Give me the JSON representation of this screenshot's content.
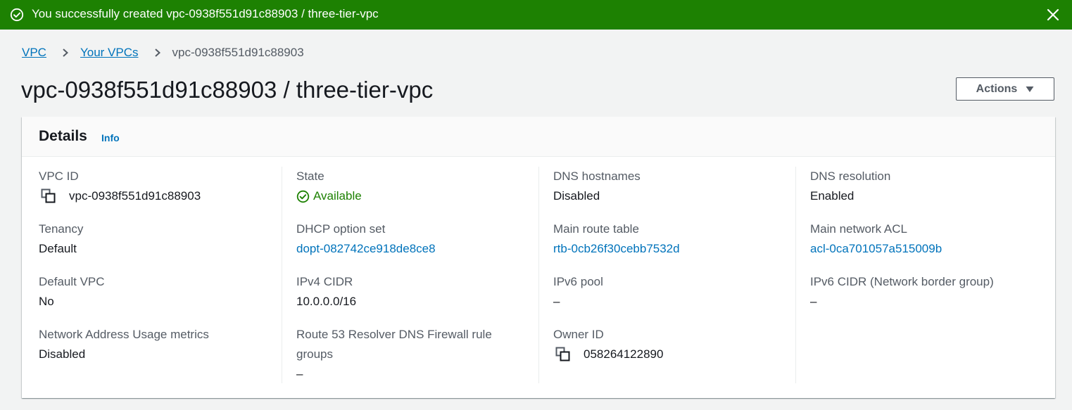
{
  "flash": {
    "message": "You successfully created vpc-0938f551d91c88903 / three-tier-vpc",
    "icon": "check-circle-icon",
    "close_icon": "close-icon",
    "color": "#1d8102"
  },
  "breadcrumb": {
    "items": [
      "VPC",
      "Your VPCs"
    ],
    "current": "vpc-0938f551d91c88903"
  },
  "header": {
    "title": "vpc-0938f551d91c88903 / three-tier-vpc",
    "actions_label": "Actions"
  },
  "details": {
    "title": "Details",
    "info_label": "Info",
    "columns": [
      [
        {
          "label": "VPC ID",
          "value": "vpc-0938f551d91c88903",
          "copy": true
        },
        {
          "label": "Tenancy",
          "value": "Default"
        },
        {
          "label": "Default VPC",
          "value": "No"
        },
        {
          "label": "Network Address Usage metrics",
          "value": "Disabled"
        }
      ],
      [
        {
          "label": "State",
          "value": "Available",
          "status": "success"
        },
        {
          "label": "DHCP option set",
          "value": "dopt-082742ce918de8ce8",
          "link": true
        },
        {
          "label": "IPv4 CIDR",
          "value": "10.0.0.0/16"
        },
        {
          "label": "Route 53 Resolver DNS Firewall rule",
          "label2": "groups",
          "value": "–"
        }
      ],
      [
        {
          "label": "DNS hostnames",
          "value": "Disabled"
        },
        {
          "label": "Main route table",
          "value": "rtb-0cb26f30cebb7532d",
          "link": true
        },
        {
          "label": "IPv6 pool",
          "value": "–"
        },
        {
          "label": "Owner ID",
          "value": "058264122890",
          "copy": true
        }
      ],
      [
        {
          "label": "DNS resolution",
          "value": "Enabled"
        },
        {
          "label": "Main network ACL",
          "value": "acl-0ca701057a515009b",
          "link": true
        },
        {
          "label": "IPv6 CIDR (Network border group)",
          "value": "–"
        }
      ]
    ]
  },
  "colors": {
    "link": "#0073bb",
    "success": "#1d8102",
    "text": "#16191f",
    "label": "#545b64"
  }
}
